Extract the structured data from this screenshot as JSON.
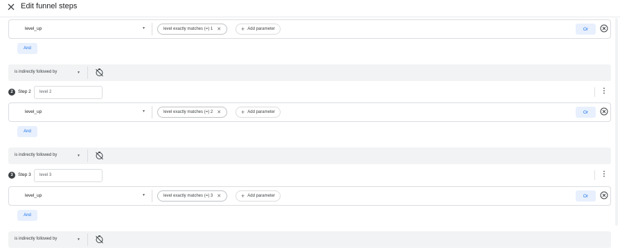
{
  "header": {
    "title": "Edit funnel steps"
  },
  "steps": [
    {
      "number": "",
      "label": "",
      "name": "",
      "event": "level_up",
      "param_chip": "level exactly matches (=) 1",
      "add_param_label": "Add parameter",
      "or_label": "Or",
      "and_label": "And",
      "sequence_label": "is indirectly followed by"
    },
    {
      "number": "2",
      "label": "Step 2",
      "name": "level 2",
      "event": "level_up",
      "param_chip": "level exactly matches (=) 2",
      "add_param_label": "Add parameter",
      "or_label": "Or",
      "and_label": "And",
      "sequence_label": "is indirectly followed by"
    },
    {
      "number": "3",
      "label": "Step 3",
      "name": "level 3",
      "event": "level_up",
      "param_chip": "level exactly matches (=) 3",
      "add_param_label": "Add parameter",
      "or_label": "Or",
      "and_label": "And",
      "sequence_label": "is indirectly followed by"
    }
  ],
  "colors": {
    "accent": "#1a73e8",
    "accent_bg": "#e8f0fe",
    "bar_bg": "#f1f3f4"
  },
  "icons": {
    "close": "close-icon",
    "remove": "remove-circle-icon",
    "timer": "timer-off-icon",
    "menu": "more-vert-icon"
  }
}
